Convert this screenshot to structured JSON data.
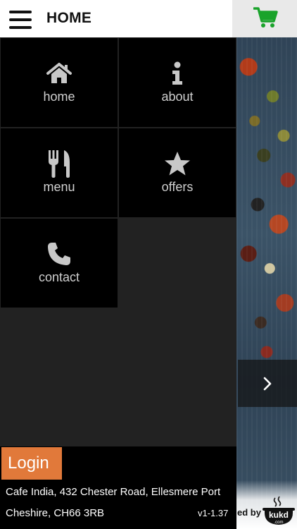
{
  "header": {
    "title": "HOME",
    "menu_icon": "hamburger-menu-icon",
    "cart_icon": "shopping-cart-icon",
    "cart_color": "#1aa32b"
  },
  "menu": {
    "tiles": [
      {
        "label": "home",
        "icon": "house-icon"
      },
      {
        "label": "about",
        "icon": "info-icon"
      },
      {
        "label": "menu",
        "icon": "fork-knife-icon"
      },
      {
        "label": "offers",
        "icon": "star-icon"
      },
      {
        "label": "contact",
        "icon": "phone-icon"
      }
    ]
  },
  "slider": {
    "next_icon": "chevron-right-icon"
  },
  "footer": {
    "login_label": "Login",
    "login_color": "#e1793a",
    "address_line1": "Cafe India, 432 Chester Road, Ellesmere Port",
    "address_line2": "Cheshire, CH66 3RB",
    "version": "v1-1.37",
    "powered_by": "ed by",
    "brand_logo_text": "kukd",
    "brand_logo_sub": ".com"
  }
}
